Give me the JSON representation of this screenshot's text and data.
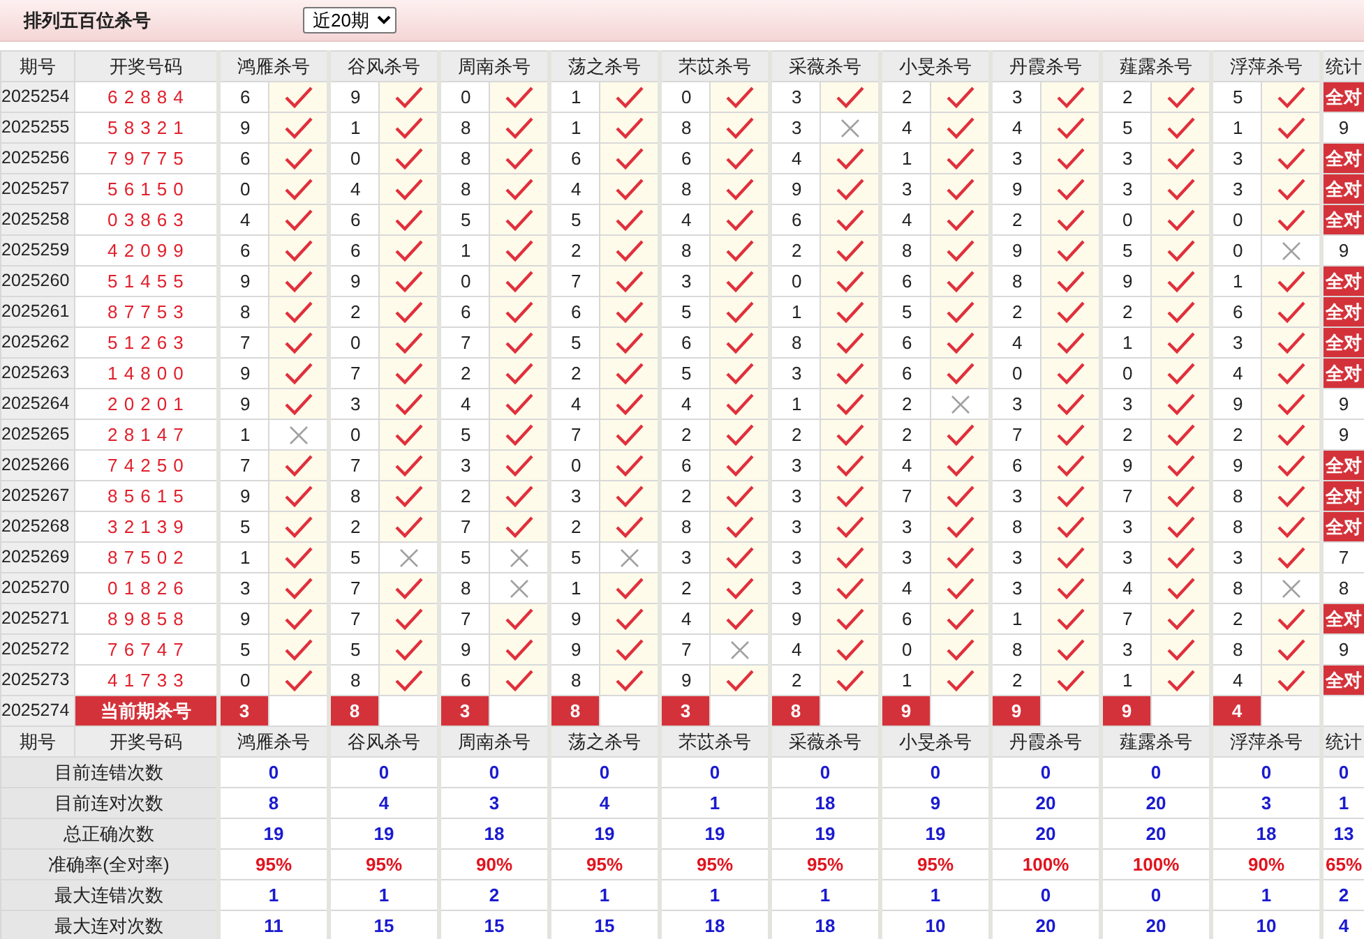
{
  "header": {
    "title": "排列五百位杀号",
    "period_select": "近20期"
  },
  "columns": {
    "period": "期号",
    "draw": "开奖号码",
    "experts": [
      "鸿雁杀号",
      "谷风杀号",
      "周南杀号",
      "荡之杀号",
      "芣苡杀号",
      "采薇杀号",
      "小旻杀号",
      "丹霞杀号",
      "薤露杀号",
      "浮萍杀号"
    ],
    "stat": "统计"
  },
  "rows": [
    {
      "period": "2025254",
      "draw": "62884",
      "picks": [
        {
          "num": "6",
          "hit": true
        },
        {
          "num": "9",
          "hit": true
        },
        {
          "num": "0",
          "hit": true
        },
        {
          "num": "1",
          "hit": true
        },
        {
          "num": "0",
          "hit": true
        },
        {
          "num": "3",
          "hit": true
        },
        {
          "num": "2",
          "hit": true
        },
        {
          "num": "3",
          "hit": true
        },
        {
          "num": "2",
          "hit": true
        },
        {
          "num": "5",
          "hit": true
        }
      ],
      "stat": {
        "text": "全对",
        "full": true
      }
    },
    {
      "period": "2025255",
      "draw": "58321",
      "picks": [
        {
          "num": "9",
          "hit": true
        },
        {
          "num": "1",
          "hit": true
        },
        {
          "num": "8",
          "hit": true
        },
        {
          "num": "1",
          "hit": true
        },
        {
          "num": "8",
          "hit": true
        },
        {
          "num": "3",
          "hit": false
        },
        {
          "num": "4",
          "hit": true
        },
        {
          "num": "4",
          "hit": true
        },
        {
          "num": "5",
          "hit": true
        },
        {
          "num": "1",
          "hit": true
        }
      ],
      "stat": {
        "text": "9",
        "full": false
      }
    },
    {
      "period": "2025256",
      "draw": "79775",
      "picks": [
        {
          "num": "6",
          "hit": true
        },
        {
          "num": "0",
          "hit": true
        },
        {
          "num": "8",
          "hit": true
        },
        {
          "num": "6",
          "hit": true
        },
        {
          "num": "6",
          "hit": true
        },
        {
          "num": "4",
          "hit": true
        },
        {
          "num": "1",
          "hit": true
        },
        {
          "num": "3",
          "hit": true
        },
        {
          "num": "3",
          "hit": true
        },
        {
          "num": "3",
          "hit": true
        }
      ],
      "stat": {
        "text": "全对",
        "full": true
      }
    },
    {
      "period": "2025257",
      "draw": "56150",
      "picks": [
        {
          "num": "0",
          "hit": true
        },
        {
          "num": "4",
          "hit": true
        },
        {
          "num": "8",
          "hit": true
        },
        {
          "num": "4",
          "hit": true
        },
        {
          "num": "8",
          "hit": true
        },
        {
          "num": "9",
          "hit": true
        },
        {
          "num": "3",
          "hit": true
        },
        {
          "num": "9",
          "hit": true
        },
        {
          "num": "3",
          "hit": true
        },
        {
          "num": "3",
          "hit": true
        }
      ],
      "stat": {
        "text": "全对",
        "full": true
      }
    },
    {
      "period": "2025258",
      "draw": "03863",
      "picks": [
        {
          "num": "4",
          "hit": true
        },
        {
          "num": "6",
          "hit": true
        },
        {
          "num": "5",
          "hit": true
        },
        {
          "num": "5",
          "hit": true
        },
        {
          "num": "4",
          "hit": true
        },
        {
          "num": "6",
          "hit": true
        },
        {
          "num": "4",
          "hit": true
        },
        {
          "num": "2",
          "hit": true
        },
        {
          "num": "0",
          "hit": true
        },
        {
          "num": "0",
          "hit": true
        }
      ],
      "stat": {
        "text": "全对",
        "full": true
      }
    },
    {
      "period": "2025259",
      "draw": "42099",
      "picks": [
        {
          "num": "6",
          "hit": true
        },
        {
          "num": "6",
          "hit": true
        },
        {
          "num": "1",
          "hit": true
        },
        {
          "num": "2",
          "hit": true
        },
        {
          "num": "8",
          "hit": true
        },
        {
          "num": "2",
          "hit": true
        },
        {
          "num": "8",
          "hit": true
        },
        {
          "num": "9",
          "hit": true
        },
        {
          "num": "5",
          "hit": true
        },
        {
          "num": "0",
          "hit": false
        }
      ],
      "stat": {
        "text": "9",
        "full": false
      }
    },
    {
      "period": "2025260",
      "draw": "51455",
      "picks": [
        {
          "num": "9",
          "hit": true
        },
        {
          "num": "9",
          "hit": true
        },
        {
          "num": "0",
          "hit": true
        },
        {
          "num": "7",
          "hit": true
        },
        {
          "num": "3",
          "hit": true
        },
        {
          "num": "0",
          "hit": true
        },
        {
          "num": "6",
          "hit": true
        },
        {
          "num": "8",
          "hit": true
        },
        {
          "num": "9",
          "hit": true
        },
        {
          "num": "1",
          "hit": true
        }
      ],
      "stat": {
        "text": "全对",
        "full": true
      }
    },
    {
      "period": "2025261",
      "draw": "87753",
      "picks": [
        {
          "num": "8",
          "hit": true
        },
        {
          "num": "2",
          "hit": true
        },
        {
          "num": "6",
          "hit": true
        },
        {
          "num": "6",
          "hit": true
        },
        {
          "num": "5",
          "hit": true
        },
        {
          "num": "1",
          "hit": true
        },
        {
          "num": "5",
          "hit": true
        },
        {
          "num": "2",
          "hit": true
        },
        {
          "num": "2",
          "hit": true
        },
        {
          "num": "6",
          "hit": true
        }
      ],
      "stat": {
        "text": "全对",
        "full": true
      }
    },
    {
      "period": "2025262",
      "draw": "51263",
      "picks": [
        {
          "num": "7",
          "hit": true
        },
        {
          "num": "0",
          "hit": true
        },
        {
          "num": "7",
          "hit": true
        },
        {
          "num": "5",
          "hit": true
        },
        {
          "num": "6",
          "hit": true
        },
        {
          "num": "8",
          "hit": true
        },
        {
          "num": "6",
          "hit": true
        },
        {
          "num": "4",
          "hit": true
        },
        {
          "num": "1",
          "hit": true
        },
        {
          "num": "3",
          "hit": true
        }
      ],
      "stat": {
        "text": "全对",
        "full": true
      }
    },
    {
      "period": "2025263",
      "draw": "14800",
      "picks": [
        {
          "num": "9",
          "hit": true
        },
        {
          "num": "7",
          "hit": true
        },
        {
          "num": "2",
          "hit": true
        },
        {
          "num": "2",
          "hit": true
        },
        {
          "num": "5",
          "hit": true
        },
        {
          "num": "3",
          "hit": true
        },
        {
          "num": "6",
          "hit": true
        },
        {
          "num": "0",
          "hit": true
        },
        {
          "num": "0",
          "hit": true
        },
        {
          "num": "4",
          "hit": true
        }
      ],
      "stat": {
        "text": "全对",
        "full": true
      }
    },
    {
      "period": "2025264",
      "draw": "20201",
      "picks": [
        {
          "num": "9",
          "hit": true
        },
        {
          "num": "3",
          "hit": true
        },
        {
          "num": "4",
          "hit": true
        },
        {
          "num": "4",
          "hit": true
        },
        {
          "num": "4",
          "hit": true
        },
        {
          "num": "1",
          "hit": true
        },
        {
          "num": "2",
          "hit": false
        },
        {
          "num": "3",
          "hit": true
        },
        {
          "num": "3",
          "hit": true
        },
        {
          "num": "9",
          "hit": true
        }
      ],
      "stat": {
        "text": "9",
        "full": false
      }
    },
    {
      "period": "2025265",
      "draw": "28147",
      "picks": [
        {
          "num": "1",
          "hit": false
        },
        {
          "num": "0",
          "hit": true
        },
        {
          "num": "5",
          "hit": true
        },
        {
          "num": "7",
          "hit": true
        },
        {
          "num": "2",
          "hit": true
        },
        {
          "num": "2",
          "hit": true
        },
        {
          "num": "2",
          "hit": true
        },
        {
          "num": "7",
          "hit": true
        },
        {
          "num": "2",
          "hit": true
        },
        {
          "num": "2",
          "hit": true
        }
      ],
      "stat": {
        "text": "9",
        "full": false
      }
    },
    {
      "period": "2025266",
      "draw": "74250",
      "picks": [
        {
          "num": "7",
          "hit": true
        },
        {
          "num": "7",
          "hit": true
        },
        {
          "num": "3",
          "hit": true
        },
        {
          "num": "0",
          "hit": true
        },
        {
          "num": "6",
          "hit": true
        },
        {
          "num": "3",
          "hit": true
        },
        {
          "num": "4",
          "hit": true
        },
        {
          "num": "6",
          "hit": true
        },
        {
          "num": "9",
          "hit": true
        },
        {
          "num": "9",
          "hit": true
        }
      ],
      "stat": {
        "text": "全对",
        "full": true
      }
    },
    {
      "period": "2025267",
      "draw": "85615",
      "picks": [
        {
          "num": "9",
          "hit": true
        },
        {
          "num": "8",
          "hit": true
        },
        {
          "num": "2",
          "hit": true
        },
        {
          "num": "3",
          "hit": true
        },
        {
          "num": "2",
          "hit": true
        },
        {
          "num": "3",
          "hit": true
        },
        {
          "num": "7",
          "hit": true
        },
        {
          "num": "3",
          "hit": true
        },
        {
          "num": "7",
          "hit": true
        },
        {
          "num": "8",
          "hit": true
        }
      ],
      "stat": {
        "text": "全对",
        "full": true
      }
    },
    {
      "period": "2025268",
      "draw": "32139",
      "picks": [
        {
          "num": "5",
          "hit": true
        },
        {
          "num": "2",
          "hit": true
        },
        {
          "num": "7",
          "hit": true
        },
        {
          "num": "2",
          "hit": true
        },
        {
          "num": "8",
          "hit": true
        },
        {
          "num": "3",
          "hit": true
        },
        {
          "num": "3",
          "hit": true
        },
        {
          "num": "8",
          "hit": true
        },
        {
          "num": "3",
          "hit": true
        },
        {
          "num": "8",
          "hit": true
        }
      ],
      "stat": {
        "text": "全对",
        "full": true
      }
    },
    {
      "period": "2025269",
      "draw": "87502",
      "picks": [
        {
          "num": "1",
          "hit": true
        },
        {
          "num": "5",
          "hit": false
        },
        {
          "num": "5",
          "hit": false
        },
        {
          "num": "5",
          "hit": false
        },
        {
          "num": "3",
          "hit": true
        },
        {
          "num": "3",
          "hit": true
        },
        {
          "num": "3",
          "hit": true
        },
        {
          "num": "3",
          "hit": true
        },
        {
          "num": "3",
          "hit": true
        },
        {
          "num": "3",
          "hit": true
        }
      ],
      "stat": {
        "text": "7",
        "full": false
      }
    },
    {
      "period": "2025270",
      "draw": "01826",
      "picks": [
        {
          "num": "3",
          "hit": true
        },
        {
          "num": "7",
          "hit": true
        },
        {
          "num": "8",
          "hit": false
        },
        {
          "num": "1",
          "hit": true
        },
        {
          "num": "2",
          "hit": true
        },
        {
          "num": "3",
          "hit": true
        },
        {
          "num": "4",
          "hit": true
        },
        {
          "num": "3",
          "hit": true
        },
        {
          "num": "4",
          "hit": true
        },
        {
          "num": "8",
          "hit": false
        }
      ],
      "stat": {
        "text": "8",
        "full": false
      }
    },
    {
      "period": "2025271",
      "draw": "89858",
      "picks": [
        {
          "num": "9",
          "hit": true
        },
        {
          "num": "7",
          "hit": true
        },
        {
          "num": "7",
          "hit": true
        },
        {
          "num": "9",
          "hit": true
        },
        {
          "num": "4",
          "hit": true
        },
        {
          "num": "9",
          "hit": true
        },
        {
          "num": "6",
          "hit": true
        },
        {
          "num": "1",
          "hit": true
        },
        {
          "num": "7",
          "hit": true
        },
        {
          "num": "2",
          "hit": true
        }
      ],
      "stat": {
        "text": "全对",
        "full": true
      }
    },
    {
      "period": "2025272",
      "draw": "76747",
      "picks": [
        {
          "num": "5",
          "hit": true
        },
        {
          "num": "5",
          "hit": true
        },
        {
          "num": "9",
          "hit": true
        },
        {
          "num": "9",
          "hit": true
        },
        {
          "num": "7",
          "hit": false
        },
        {
          "num": "4",
          "hit": true
        },
        {
          "num": "0",
          "hit": true
        },
        {
          "num": "8",
          "hit": true
        },
        {
          "num": "3",
          "hit": true
        },
        {
          "num": "8",
          "hit": true
        }
      ],
      "stat": {
        "text": "9",
        "full": false
      }
    },
    {
      "period": "2025273",
      "draw": "41733",
      "picks": [
        {
          "num": "0",
          "hit": true
        },
        {
          "num": "8",
          "hit": true
        },
        {
          "num": "6",
          "hit": true
        },
        {
          "num": "8",
          "hit": true
        },
        {
          "num": "9",
          "hit": true
        },
        {
          "num": "2",
          "hit": true
        },
        {
          "num": "1",
          "hit": true
        },
        {
          "num": "2",
          "hit": true
        },
        {
          "num": "1",
          "hit": true
        },
        {
          "num": "4",
          "hit": true
        }
      ],
      "stat": {
        "text": "全对",
        "full": true
      }
    }
  ],
  "current": {
    "period": "2025274",
    "label": "当前期杀号",
    "picks": [
      "3",
      "8",
      "3",
      "8",
      "3",
      "8",
      "9",
      "9",
      "9",
      "4"
    ]
  },
  "summary_columns": {
    "period": "期号",
    "draw": "开奖号码",
    "experts": [
      "鸿雁杀号",
      "谷风杀号",
      "周南杀号",
      "荡之杀号",
      "芣苡杀号",
      "采薇杀号",
      "小旻杀号",
      "丹霞杀号",
      "薤露杀号",
      "浮萍杀号"
    ],
    "stat": "统计"
  },
  "summary": [
    {
      "label": "目前连错次数",
      "values": [
        "0",
        "0",
        "0",
        "0",
        "0",
        "0",
        "0",
        "0",
        "0",
        "0"
      ],
      "stat": "0",
      "kind": "count"
    },
    {
      "label": "目前连对次数",
      "values": [
        "8",
        "4",
        "3",
        "4",
        "1",
        "18",
        "9",
        "20",
        "20",
        "3"
      ],
      "stat": "1",
      "kind": "count"
    },
    {
      "label": "总正确次数",
      "values": [
        "19",
        "19",
        "18",
        "19",
        "19",
        "19",
        "19",
        "20",
        "20",
        "18"
      ],
      "stat": "13",
      "kind": "count"
    },
    {
      "label": "准确率(全对率)",
      "values": [
        "95%",
        "95%",
        "90%",
        "95%",
        "95%",
        "95%",
        "95%",
        "100%",
        "100%",
        "90%"
      ],
      "stat": "65%",
      "kind": "rate"
    },
    {
      "label": "最大连错次数",
      "values": [
        "1",
        "1",
        "2",
        "1",
        "1",
        "1",
        "1",
        "0",
        "0",
        "1"
      ],
      "stat": "2",
      "kind": "count"
    },
    {
      "label": "最大连对次数",
      "values": [
        "11",
        "15",
        "15",
        "15",
        "18",
        "18",
        "10",
        "20",
        "20",
        "10"
      ],
      "stat": "4",
      "kind": "count"
    }
  ]
}
